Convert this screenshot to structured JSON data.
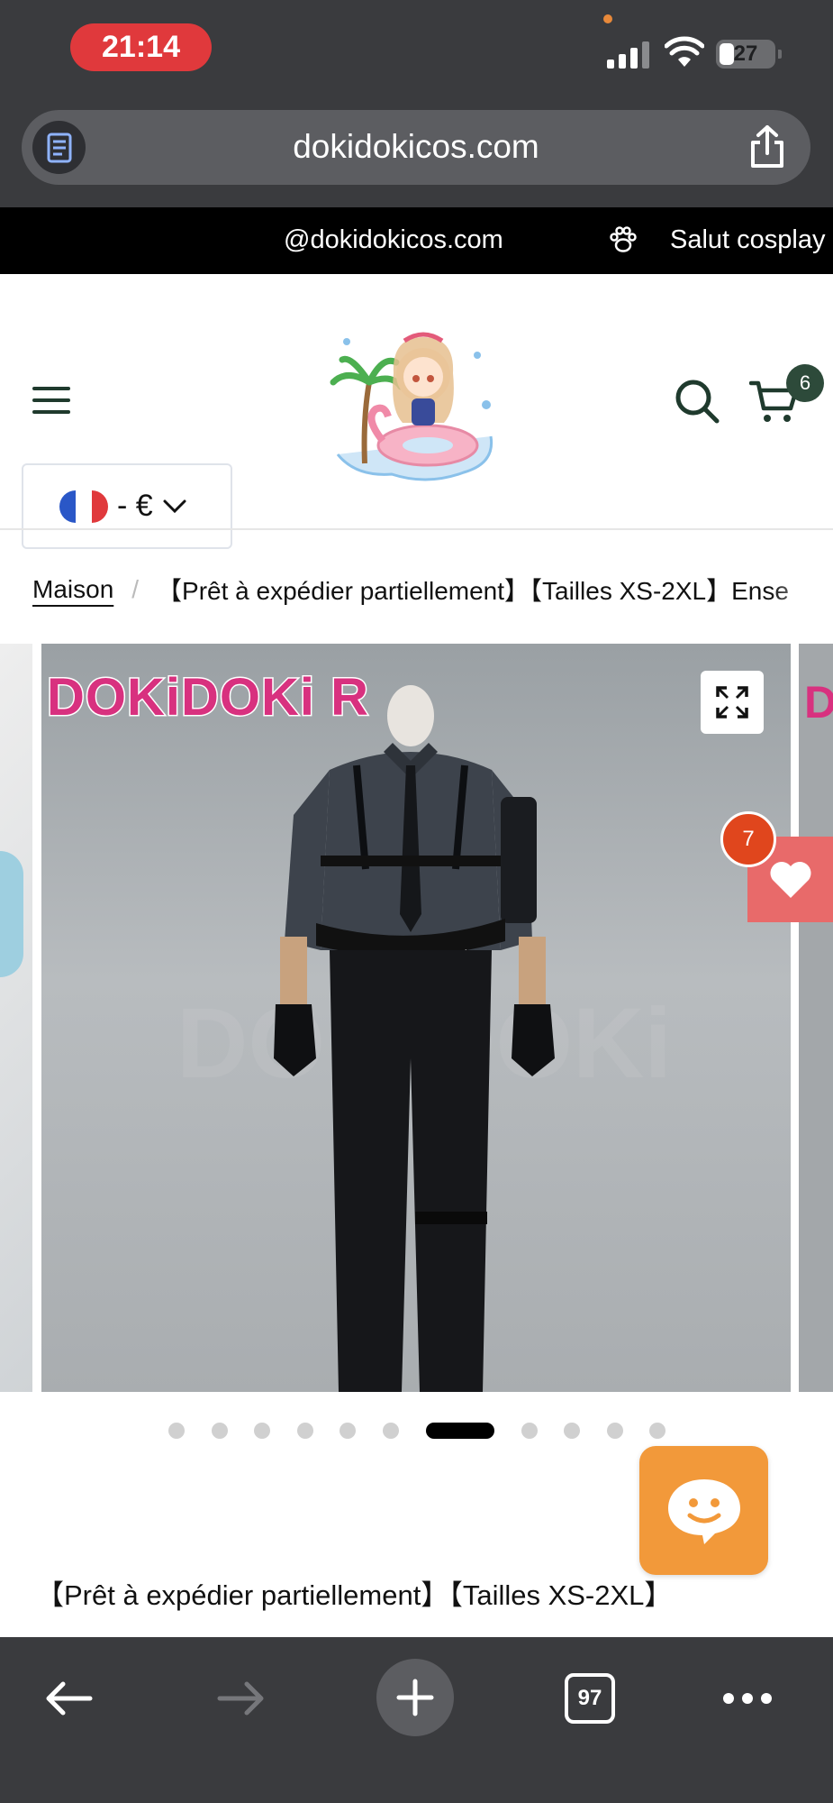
{
  "status_bar": {
    "time": "21:14",
    "battery": "27"
  },
  "browser": {
    "url": "dokidokicos.com",
    "open_tabs": "97"
  },
  "announcement": {
    "email": "@dokidokicos.com",
    "greeting": "Salut cosplay"
  },
  "header": {
    "cart_count": "6",
    "currency": "- €"
  },
  "breadcrumb": {
    "home": "Maison",
    "separator": "/",
    "current": "【Prêt à expédier partiellement】【Tailles XS-2XL】Ense"
  },
  "gallery": {
    "brand_text": "DOKiDOKi R",
    "next_brand_fragment": "D",
    "watermark": "DOKiDOKi",
    "wishlist_count": "7",
    "dot_count": 11,
    "active_dot_index": 6
  },
  "product": {
    "title": "【Prêt à expédier partiellement】【Tailles XS-2XL】"
  },
  "icons": [
    "reader-icon",
    "share-icon",
    "paw-icon",
    "menu-icon",
    "search-icon",
    "cart-icon",
    "chevron-down-icon",
    "expand-icon",
    "heart-icon",
    "chat-icon",
    "back-icon",
    "forward-icon",
    "plus-icon",
    "more-icon"
  ],
  "colors": {
    "brand_pink": "#d8317f",
    "chat_orange": "#f2993a",
    "wishlist": "#e86a6a",
    "time_pill": "#e0393c",
    "cart_badge": "#2d4a3a"
  }
}
